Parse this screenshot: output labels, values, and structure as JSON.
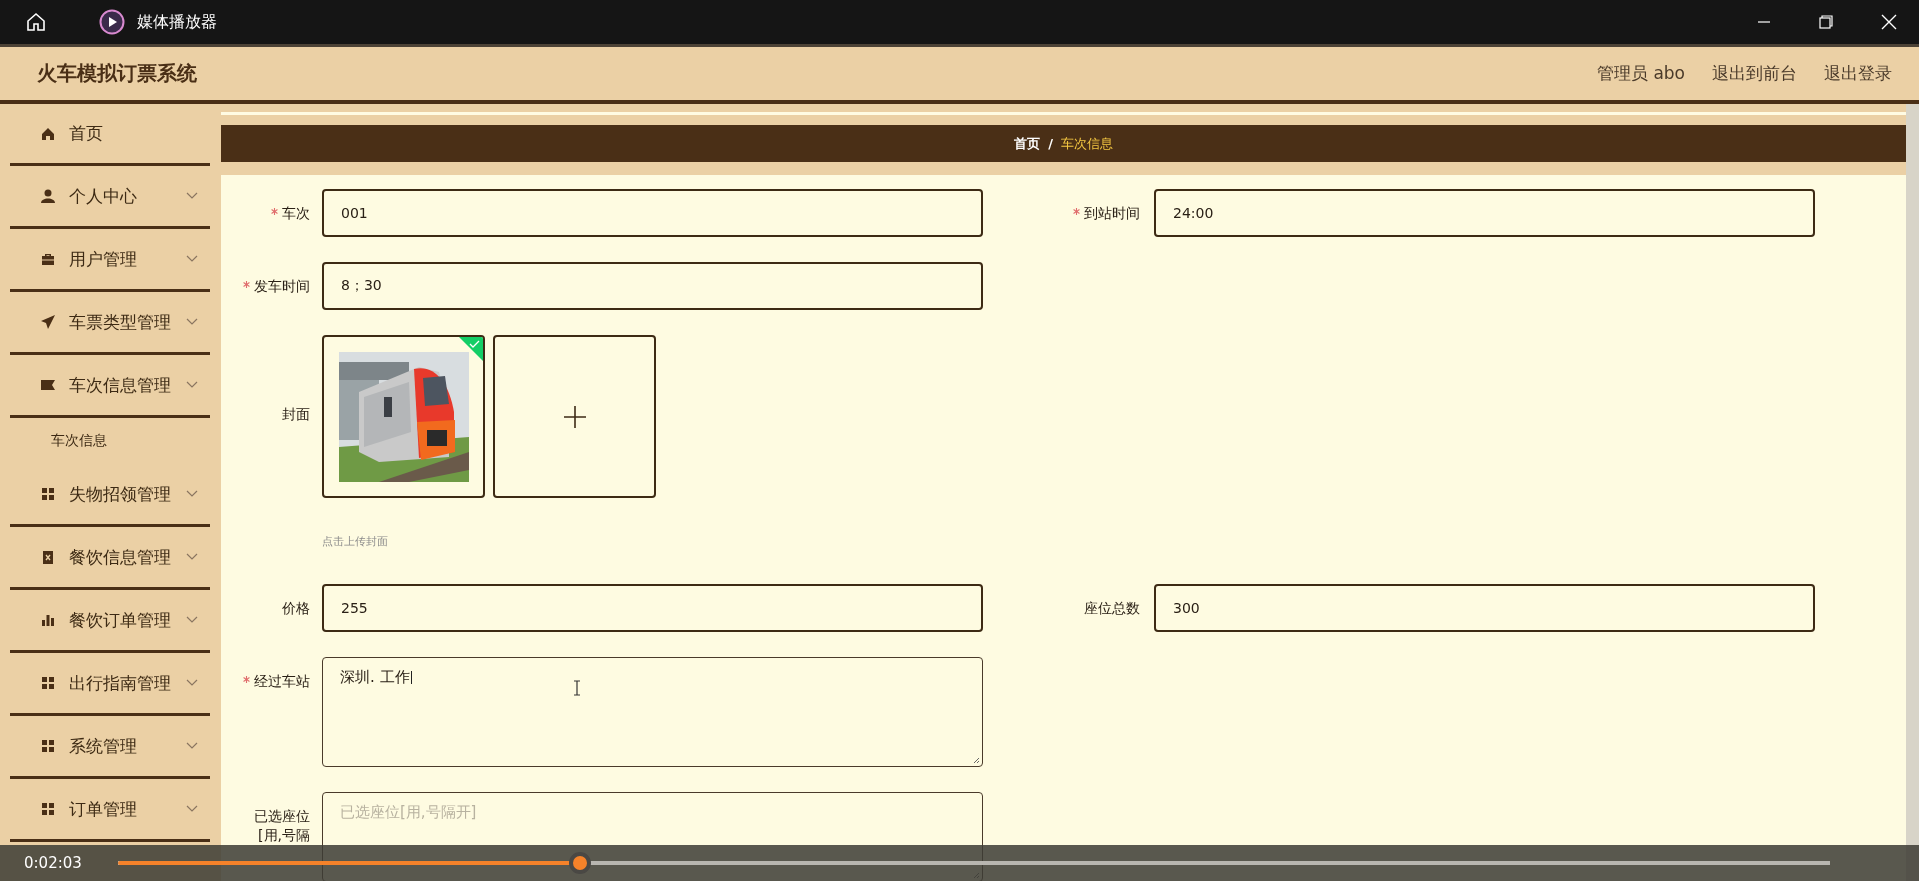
{
  "player": {
    "title": "媒体播放器"
  },
  "app": {
    "title": "火车模拟订票系统",
    "user": "管理员 abo",
    "links": [
      "退出到前台",
      "退出登录"
    ]
  },
  "sidebar": {
    "items": [
      {
        "label": "首页",
        "kind": "link"
      },
      {
        "label": "个人中心",
        "kind": "menu"
      },
      {
        "label": "用户管理",
        "kind": "menu"
      },
      {
        "label": "车票类型管理",
        "kind": "menu"
      },
      {
        "label": "车次信息管理",
        "kind": "menu",
        "children": [
          {
            "label": "车次信息"
          }
        ]
      },
      {
        "label": "失物招领管理",
        "kind": "menu"
      },
      {
        "label": "餐饮信息管理",
        "kind": "menu"
      },
      {
        "label": "餐饮订单管理",
        "kind": "menu"
      },
      {
        "label": "出行指南管理",
        "kind": "menu"
      },
      {
        "label": "系统管理",
        "kind": "menu"
      },
      {
        "label": "订单管理",
        "kind": "menu"
      }
    ]
  },
  "breadcrumb": {
    "separator": "/",
    "items": [
      {
        "label": "首页",
        "selected": false
      },
      {
        "label": "车次信息",
        "selected": true
      }
    ]
  },
  "form": {
    "rows": [
      {
        "fields": [
          {
            "label": "车次",
            "kind": "input",
            "required": true,
            "value": "001"
          },
          {
            "label": "到站时间",
            "kind": "input",
            "required": true,
            "value": "24:00"
          }
        ]
      },
      {
        "fields": [
          {
            "label": "发车时间",
            "kind": "input",
            "required": true,
            "value": "8；30"
          }
        ]
      },
      {
        "fields": [
          {
            "label": "封面",
            "kind": "upload",
            "required": false,
            "uploaded": true,
            "hint": "点击上传封面"
          }
        ]
      },
      {
        "fields": [
          {
            "label": "价格",
            "kind": "input",
            "required": false,
            "value": "255"
          },
          {
            "label": "座位总数",
            "kind": "input",
            "required": false,
            "value": "300"
          }
        ]
      },
      {
        "fields": [
          {
            "label": "经过车站",
            "kind": "textarea",
            "required": true,
            "value": "深圳. 工作"
          }
        ]
      },
      {
        "fields": [
          {
            "label": "已选座位",
            "label_extra": "[用,号隔",
            "kind": "textarea",
            "required": false,
            "placeholder": "已选座位[用,号隔开]"
          }
        ]
      }
    ]
  },
  "media": {
    "elapsed": "0:02:03",
    "level": 0.27
  }
}
